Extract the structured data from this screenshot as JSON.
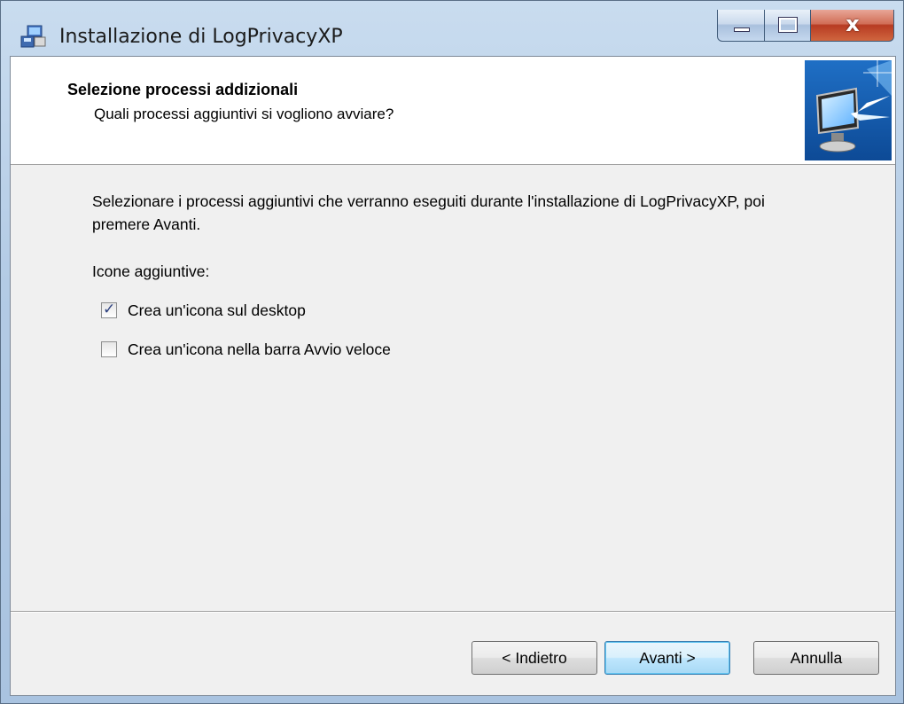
{
  "window": {
    "title": "Installazione di LogPrivacyXP",
    "app_icon": "installer-icon",
    "controls": {
      "minimize": "minimize-icon",
      "maximize": "maximize-icon",
      "close_glyph": "x"
    }
  },
  "header": {
    "title": "Selezione processi addizionali",
    "subtitle": "Quali processi aggiuntivi si vogliono avviare?",
    "image": "computer-monitor-icon"
  },
  "content": {
    "intro": "Selezionare i processi aggiuntivi che verranno eseguiti durante l'installazione di LogPrivacyXP, poi premere Avanti.",
    "group_label": "Icone aggiuntive:",
    "options": [
      {
        "label": "Crea un'icona sul desktop",
        "checked": true
      },
      {
        "label": "Crea un'icona nella barra Avvio veloce",
        "checked": false
      }
    ]
  },
  "buttons": {
    "back": "< Indietro",
    "next": "Avanti >",
    "cancel": "Annulla"
  },
  "colors": {
    "accent": "#3c7fb1",
    "close": "#c2482c"
  }
}
